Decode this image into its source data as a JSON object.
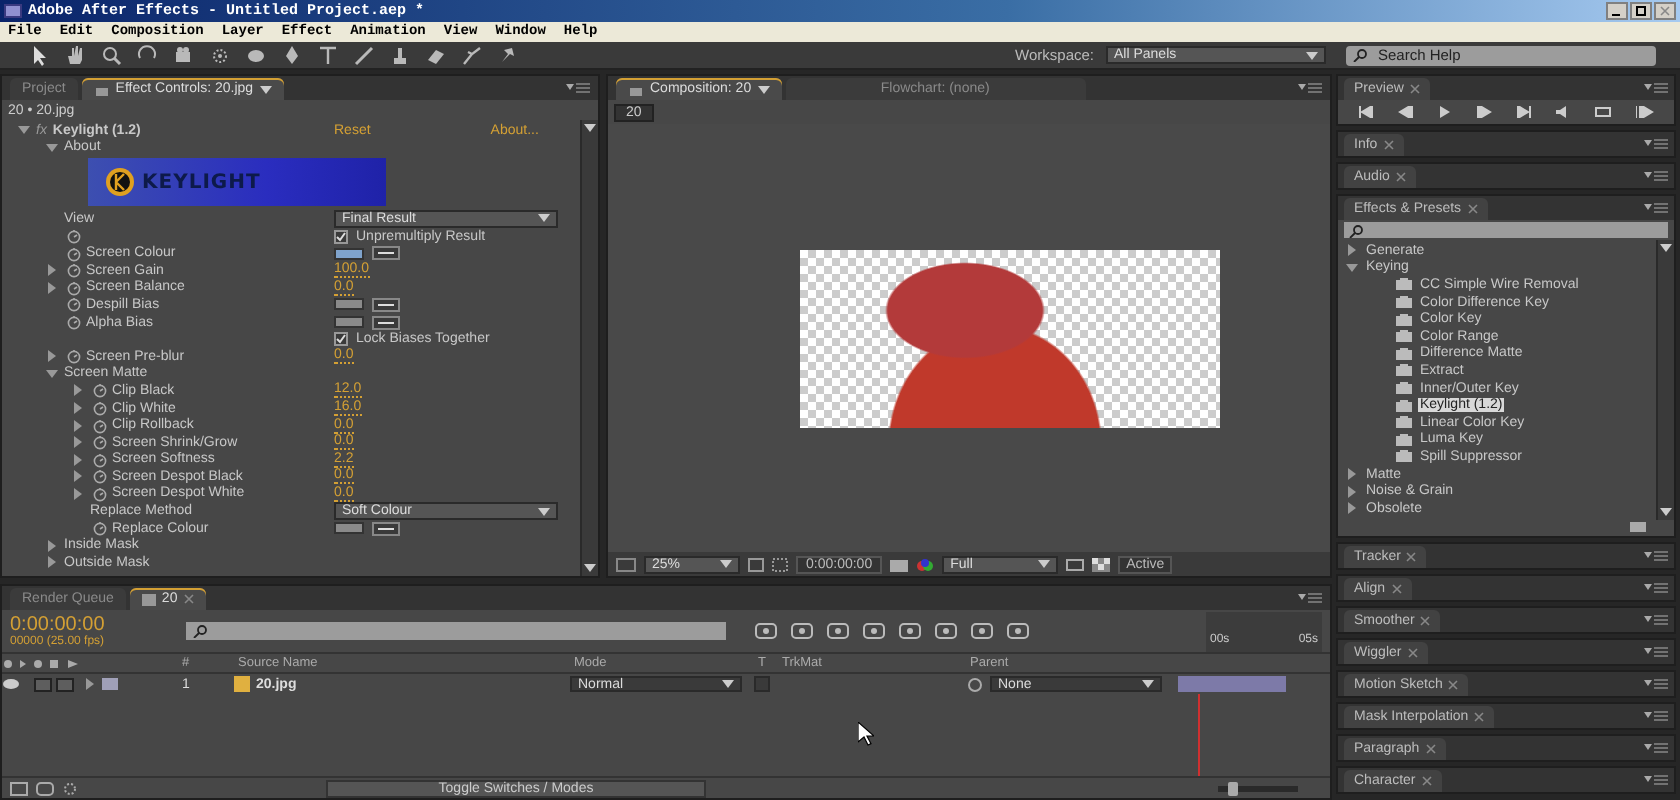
{
  "window": {
    "title": "Adobe After Effects - Untitled Project.aep *"
  },
  "menu": [
    "File",
    "Edit",
    "Composition",
    "Layer",
    "Effect",
    "Animation",
    "View",
    "Window",
    "Help"
  ],
  "workspace": {
    "label": "Workspace:",
    "value": "All Panels"
  },
  "search_help": {
    "placeholder": "Search Help"
  },
  "effect_controls": {
    "tabs": [
      {
        "label": "Project",
        "selected": false
      },
      {
        "label": "Effect Controls: 20.jpg",
        "selected": true
      }
    ],
    "breadcrumb": "20 • 20.jpg",
    "effect": {
      "icon": "fx",
      "name": "Keylight (1.2)",
      "expanded": true,
      "reset": "Reset",
      "about": "About..."
    },
    "rows": [
      {
        "kind": "group",
        "label": "About",
        "expanded": true,
        "children": [
          {
            "kind": "banner",
            "label": "KEYLIGHT"
          }
        ]
      },
      {
        "kind": "dropdown",
        "label": "View",
        "value": "Final Result"
      },
      {
        "kind": "checkbox",
        "label": "Unpremultiply Result",
        "checked": true,
        "stopwatch": true
      },
      {
        "kind": "color",
        "label": "Screen Colour",
        "color": "#7fa3cc"
      },
      {
        "kind": "number",
        "label": "Screen Gain",
        "value": "100.0"
      },
      {
        "kind": "number",
        "label": "Screen Balance",
        "value": "0.0"
      },
      {
        "kind": "color",
        "label": "Despill Bias",
        "color": "#8a8a8a"
      },
      {
        "kind": "color",
        "label": "Alpha Bias",
        "color": "#8a8a8a"
      },
      {
        "kind": "checkbox",
        "label": "Lock Biases Together",
        "checked": true,
        "stopwatch": false
      },
      {
        "kind": "number",
        "label": "Screen Pre-blur",
        "value": "0.0"
      },
      {
        "kind": "group",
        "label": "Screen Matte",
        "expanded": true,
        "children": [
          {
            "kind": "number",
            "label": "Clip Black",
            "value": "12.0"
          },
          {
            "kind": "number",
            "label": "Clip White",
            "value": "16.0"
          },
          {
            "kind": "number",
            "label": "Clip Rollback",
            "value": "0.0"
          },
          {
            "kind": "number",
            "label": "Screen Shrink/Grow",
            "value": "0.0"
          },
          {
            "kind": "number",
            "label": "Screen Softness",
            "value": "2.2"
          },
          {
            "kind": "number",
            "label": "Screen Despot Black",
            "value": "0.0"
          },
          {
            "kind": "number",
            "label": "Screen Despot White",
            "value": "0.0"
          },
          {
            "kind": "dropdown",
            "label": "Replace Method",
            "value": "Soft Colour"
          },
          {
            "kind": "color",
            "label": "Replace Colour",
            "color": "#8a8a8a"
          }
        ]
      },
      {
        "kind": "group",
        "label": "Inside Mask",
        "expanded": false
      },
      {
        "kind": "group",
        "label": "Outside Mask",
        "expanded": false
      }
    ]
  },
  "composition": {
    "tabs": [
      {
        "label": "Composition: 20",
        "selected": true
      },
      {
        "label": "Flowchart: (none)",
        "selected": false
      }
    ],
    "breadcrumb": "20",
    "zoom": "25%",
    "timecode": "0:00:00:00",
    "resolution": "Full",
    "view": "Active"
  },
  "right_panels": [
    {
      "kind": "preview",
      "label": "Preview"
    },
    {
      "kind": "collapsed",
      "label": "Info"
    },
    {
      "kind": "collapsed",
      "label": "Audio"
    },
    {
      "kind": "effects",
      "label": "Effects & Presets",
      "tree": [
        {
          "label": "Generate",
          "expanded": false
        },
        {
          "label": "Keying",
          "expanded": true,
          "children": [
            {
              "label": "CC Simple Wire Removal",
              "selected": false
            },
            {
              "label": "Color Difference Key",
              "selected": false
            },
            {
              "label": "Color Key",
              "selected": false
            },
            {
              "label": "Color Range",
              "selected": false
            },
            {
              "label": "Difference Matte",
              "selected": false
            },
            {
              "label": "Extract",
              "selected": false
            },
            {
              "label": "Inner/Outer Key",
              "selected": false
            },
            {
              "label": "Keylight (1.2)",
              "selected": true
            },
            {
              "label": "Linear Color Key",
              "selected": false
            },
            {
              "label": "Luma Key",
              "selected": false
            },
            {
              "label": "Spill Suppressor",
              "selected": false
            }
          ]
        },
        {
          "label": "Matte",
          "expanded": false
        },
        {
          "label": "Noise & Grain",
          "expanded": false
        },
        {
          "label": "Obsolete",
          "expanded": false
        }
      ]
    },
    {
      "kind": "collapsed",
      "label": "Tracker"
    },
    {
      "kind": "collapsed",
      "label": "Align"
    },
    {
      "kind": "collapsed",
      "label": "Smoother"
    },
    {
      "kind": "collapsed",
      "label": "Wiggler"
    },
    {
      "kind": "collapsed",
      "label": "Motion Sketch"
    },
    {
      "kind": "collapsed",
      "label": "Mask Interpolation"
    },
    {
      "kind": "collapsed",
      "label": "Paragraph"
    },
    {
      "kind": "collapsed",
      "label": "Character"
    }
  ],
  "timeline": {
    "tabs": [
      {
        "label": "Render Queue",
        "selected": false
      },
      {
        "label": "20",
        "selected": true
      }
    ],
    "timecode": "0:00:00:00",
    "fps": "00000 (25.00 fps)",
    "columns": [
      "#",
      "Source Name",
      "Mode",
      "T",
      "TrkMat",
      "Parent"
    ],
    "ruler": [
      "00s",
      "05s"
    ],
    "layers": [
      {
        "visible": true,
        "expanded": false,
        "number": "1",
        "source_name": "20.jpg",
        "mode": "Normal",
        "parent": "None"
      }
    ],
    "toggle": "Toggle Switches / Modes",
    "zoom_slider": {
      "level": 0.15
    }
  }
}
